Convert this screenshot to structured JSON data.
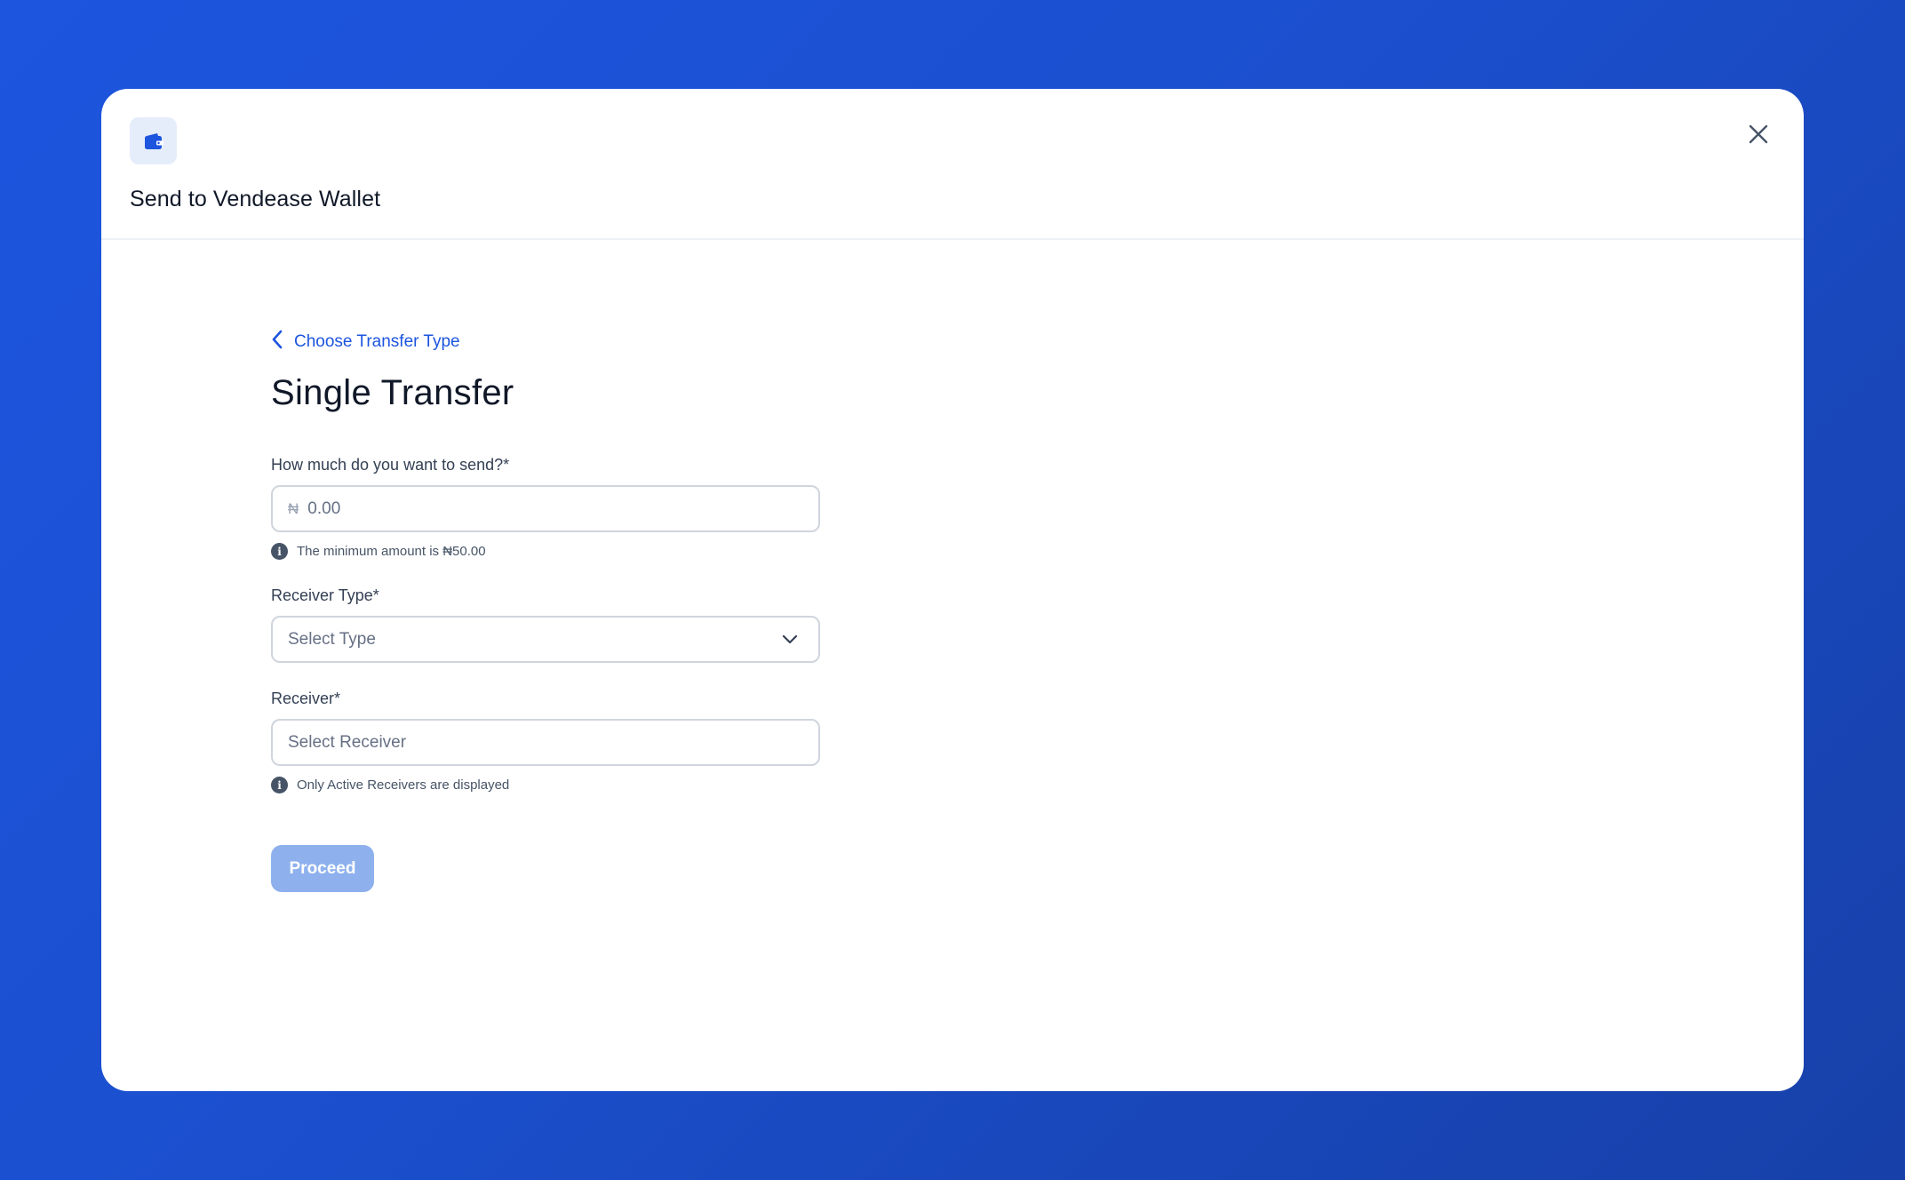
{
  "modal": {
    "title": "Send to Vendease Wallet",
    "header_icon": "wallet-icon",
    "close_icon": "close-icon"
  },
  "form": {
    "back_link_label": "Choose Transfer Type",
    "page_title": "Single Transfer",
    "amount": {
      "label": "How much do you want to send?*",
      "currency_symbol": "₦",
      "placeholder": "0.00",
      "hint": "The minimum amount is ₦50.00"
    },
    "receiver_type": {
      "label": "Receiver Type*",
      "placeholder": "Select Type"
    },
    "receiver": {
      "label": "Receiver*",
      "placeholder": "Select Receiver",
      "hint": "Only Active Receivers are displayed"
    },
    "proceed_label": "Proceed"
  },
  "colors": {
    "background": "#1d55df",
    "accent": "#1d55df",
    "button_disabled": "#8eb1ee",
    "icon_box": "#e5edfb"
  }
}
